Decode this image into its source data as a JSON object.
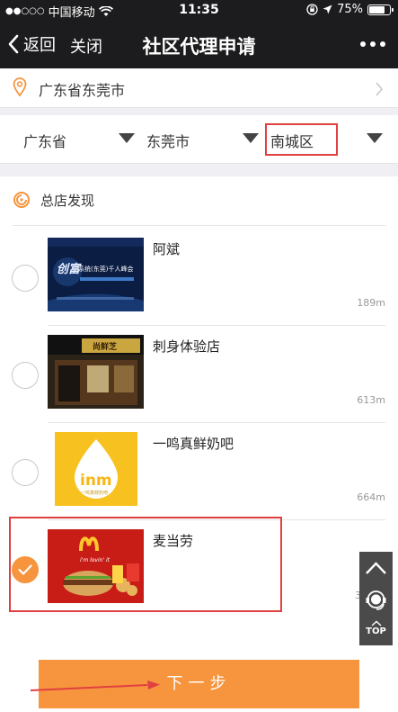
{
  "status_bar": {
    "carrier_dots": "●●○○○",
    "carrier": "中国移动",
    "time": "11:35",
    "battery": "75%",
    "battery_level": 0.75
  },
  "nav": {
    "back_label": "返回",
    "close_label": "关闭",
    "title": "社区代理申请"
  },
  "location": {
    "text": "广东省东莞市"
  },
  "selectors": {
    "province": "广东省",
    "city": "东莞市",
    "district": "南城区"
  },
  "section": {
    "title": "总店发现"
  },
  "stores": [
    {
      "name": "阿斌",
      "distance": "189m",
      "selected": false
    },
    {
      "name": "刺身体验店",
      "distance": "613m",
      "selected": false
    },
    {
      "name": "一鸣真鲜奶吧",
      "distance": "664m",
      "selected": false
    },
    {
      "name": "麦当劳",
      "distance": "3",
      "selected": true
    }
  ],
  "thumb_text": {
    "store1_banner": "系统(东莞)千人峰会",
    "store1_side": "创富",
    "store2_sign": "尚鲜芝",
    "store3_logo": "inm",
    "store3_sub": "一鸣真鲜奶吧",
    "store4_slogan": "i'm lovin' it"
  },
  "float_panel": {
    "top_label": "TOP"
  },
  "footer": {
    "next_label": "下一步"
  },
  "colors": {
    "accent": "#f7943e",
    "highlight_box": "#e04040",
    "header_bg": "#1c1c1e"
  }
}
